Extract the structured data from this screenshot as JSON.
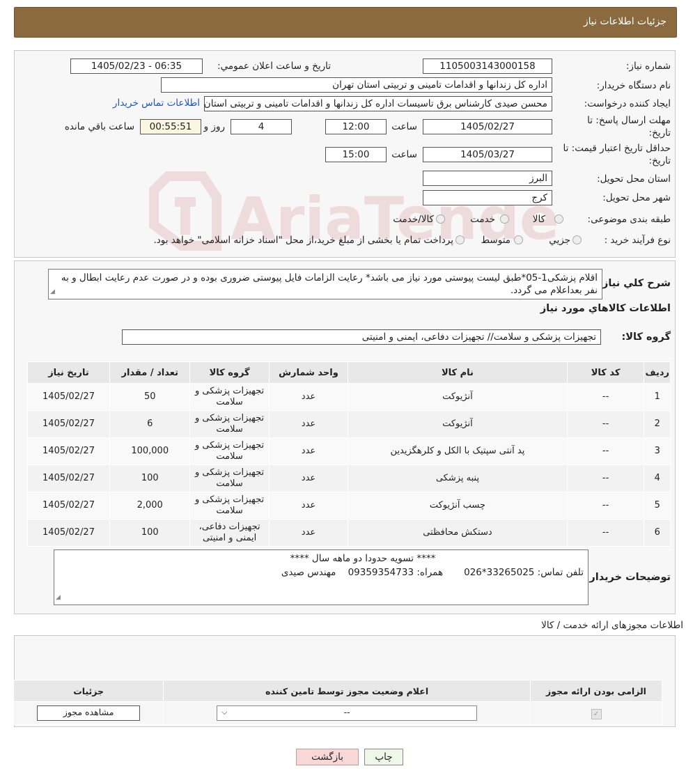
{
  "header": {
    "title": "جزئیات اطلاعات نیاز"
  },
  "form": {
    "need_number_label": "شماره نیاز:",
    "need_number": "1105003143000158",
    "announce_label": "تاریخ و ساعت اعلان عمومي:",
    "announce_value": "1405/02/23 - 06:35",
    "buyer_label": "نام دستگاه خريدار:",
    "buyer_value": "اداره کل زندانها و اقدامات تامینی و تربیتی استان تهران",
    "creator_label": "ايجاد کننده درخواست:",
    "creator_value": "محسن صیدی کارشناس برق تاسیسات  اداره کل زندانها و اقدامات تامینی و تربیتی استان تهران",
    "contact_link": "اطلاعات تماس خريدار",
    "deadline_label_1": "مهلت ارسال پاسخ: تا",
    "deadline_label_2": "تاريخ:",
    "deadline_date": "1405/02/27",
    "time_label": "ساعت",
    "deadline_time": "12:00",
    "days_value": "4",
    "days_label": "روز و",
    "remaining_time": "00:55:51",
    "remaining_label": "ساعت باقي مانده",
    "validity_label_1": "حداقل تاريخ اعتبار قيمت: تا",
    "validity_label_2": "تاريخ:",
    "validity_date": "1405/03/27",
    "validity_time": "15:00",
    "province_label": "استان محل تحويل:",
    "province_value": "البرز",
    "city_label": "شهر محل تحويل:",
    "city_value": "کرج",
    "category_label": "طبقه بندی موضوعی:",
    "category_opt1": "کالا",
    "category_opt2": "خدمت",
    "category_opt3": "کالا/خدمت",
    "process_label": "نوع فرآيند خريد :",
    "process_opt1": "جزيي",
    "process_opt2": "متوسط",
    "process_note": "پرداخت تمام يا بخشی از مبلغ خريد،از محل \"اسناد خزانه اسلامی\" خواهد بود."
  },
  "description": {
    "label": "شرح کلي نياز:",
    "text": "اقلام پزشکی1-05*طبق لیست پیوستی مورد نیاز می باشد* رعایت الزامات فایل پیوستی ضروری بوده و در صورت عدم رعایت ابطال و به نفر بعداعلام می گردد."
  },
  "goods": {
    "section_title": "اطلاعات کالاهاي مورد نياز",
    "group_label": "گروه کالا:",
    "group_value": "تجهیزات پزشکی و سلامت// تجهیزات دفاعی، ایمنی و امنیتی",
    "columns": [
      "رديف",
      "کد کالا",
      "نام کالا",
      "واحد شمارش",
      "گروه کالا",
      "تعداد / مقدار",
      "تاريخ نياز"
    ],
    "rows": [
      {
        "row": "1",
        "code": "--",
        "name": "آنژیوکت",
        "unit": "عدد",
        "group": "تجهیزات پزشکی و سلامت",
        "qty": "50",
        "date": "1405/02/27"
      },
      {
        "row": "2",
        "code": "--",
        "name": "آنژیوکت",
        "unit": "عدد",
        "group": "تجهیزات پزشکی و سلامت",
        "qty": "6",
        "date": "1405/02/27"
      },
      {
        "row": "3",
        "code": "--",
        "name": "پد آنتی سپتیک با الکل و کلرهگزیدین",
        "unit": "عدد",
        "group": "تجهیزات پزشکی و سلامت",
        "qty": "100,000",
        "date": "1405/02/27"
      },
      {
        "row": "4",
        "code": "--",
        "name": "پنبه پزشکی",
        "unit": "عدد",
        "group": "تجهیزات پزشکی و سلامت",
        "qty": "100",
        "date": "1405/02/27"
      },
      {
        "row": "5",
        "code": "--",
        "name": "چسب آنژیوکت",
        "unit": "عدد",
        "group": "تجهیزات پزشکی و سلامت",
        "qty": "2,000",
        "date": "1405/02/27"
      },
      {
        "row": "6",
        "code": "--",
        "name": "دستکش محافظتی",
        "unit": "عدد",
        "group": "تجهیزات دفاعی، ایمنی و امنیتی",
        "qty": "100",
        "date": "1405/02/27"
      }
    ]
  },
  "buyer_notes": {
    "label": "توضيحات خريدار:",
    "line1": "**** تسویه حدودا دو ماهه سال ****",
    "line2": "تلفن تماس: 33265025*026       همراه: 09359354733    مهندس صیدی"
  },
  "licenses": {
    "title": "اطلاعات مجوزهای ارائه خدمت / کالا",
    "columns": [
      "الزامی بودن ارائه مجوز",
      "اعلام وضعیت مجوز توسط تامين کننده",
      "جزئيات"
    ],
    "select_value": "--",
    "view_button": "مشاهده مجوز"
  },
  "buttons": {
    "print": "چاپ",
    "back": "بازگشت"
  },
  "watermark": {
    "text": "AriaTender.neT"
  },
  "colors": {
    "header_bg": "#8b6a3f",
    "link": "#1a56c4",
    "back_btn": "#f8d7d7",
    "print_btn": "#eef7e8"
  }
}
